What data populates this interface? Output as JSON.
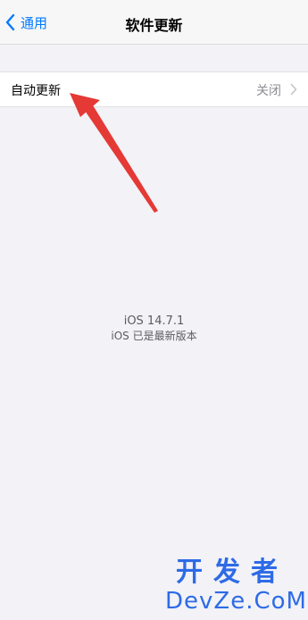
{
  "nav": {
    "back_label": "通用",
    "title": "软件更新"
  },
  "settings": {
    "auto_update_label": "自动更新",
    "auto_update_value": "关闭"
  },
  "version": {
    "number": "iOS 14.7.1",
    "status": "iOS 已是最新版本"
  },
  "watermark": {
    "top": "开发者",
    "bottom": "DevZe.CoM"
  },
  "colors": {
    "accent": "#007aff",
    "annotation_arrow": "#e53935",
    "watermark": "#2d6be6"
  },
  "icons": {
    "back": "chevron-left-icon",
    "row": "chevron-right-icon"
  }
}
